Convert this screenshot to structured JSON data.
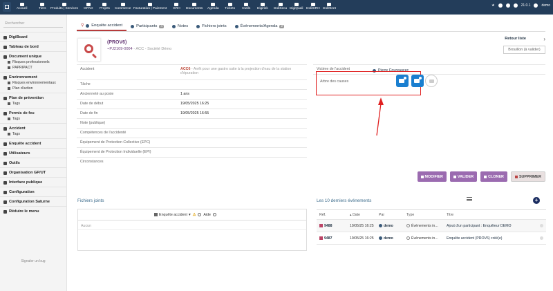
{
  "topbar": {
    "items": [
      "Accueil",
      "Tiers",
      "Produits | Services",
      "GPAO",
      "Projets",
      "Commerce",
      "Facturation | Paiement",
      "GRH",
      "Documents",
      "Agenda",
      "Tickets",
      "Outils",
      "Digirisk",
      "DoliSecu",
      "DigiQuali",
      "DoliSIRH",
      "DoliMeet"
    ],
    "version": "21.0.1",
    "user": "demo"
  },
  "sidebar": {
    "search_placeholder": "Rechercher",
    "groups": [
      {
        "label": "DigiBoard",
        "subs": []
      },
      {
        "label": "Tableau de bord",
        "subs": []
      },
      {
        "label": "Document unique",
        "subs": [
          "Risques professionnels",
          "PAPRIPACT"
        ]
      },
      {
        "label": "Environnement",
        "subs": [
          "Risques environnementaux",
          "Plan d'action"
        ]
      },
      {
        "label": "Plan de prévention",
        "subs": [
          "Tags"
        ]
      },
      {
        "label": "Permis de feu",
        "subs": [
          "Tags"
        ]
      },
      {
        "label": "Accident",
        "subs": [
          "Tags"
        ]
      },
      {
        "label": "Enquête accident",
        "subs": []
      },
      {
        "label": "Utilisateurs",
        "subs": []
      },
      {
        "label": "Outils",
        "subs": []
      },
      {
        "label": "Organisation GP/UT",
        "subs": []
      },
      {
        "label": "Interface publique",
        "subs": []
      },
      {
        "label": "Configuration",
        "subs": []
      },
      {
        "label": "Configuration Saturne",
        "subs": []
      },
      {
        "label": "Réduire le menu",
        "subs": []
      }
    ],
    "bug": "Signaler un bug"
  },
  "tabs": [
    {
      "label": "Enquête accident",
      "badge": ""
    },
    {
      "label": "Participants",
      "badge": "4"
    },
    {
      "label": "Notes",
      "badge": ""
    },
    {
      "label": "Fichiers joints",
      "badge": ""
    },
    {
      "label": "Événements/Agenda",
      "badge": "2"
    }
  ],
  "record": {
    "ref": "(PROV6)",
    "ref2": "PJ2109-0004",
    "ref2_suffix": "- ACC - Société Démo",
    "back": "Retour liste",
    "status": "Brouillon (à valider)"
  },
  "fields": [
    {
      "label": "Accident",
      "value_code": "ACC6",
      "value": " - Arrêt pour une gastro suite à la projection d'eau de la station d'épuration"
    },
    {
      "label": "Tâche",
      "value_code": "",
      "value": ""
    },
    {
      "label": "Ancienneté au poste",
      "value_code": "",
      "value": "1 ans"
    },
    {
      "label": "Date de début",
      "value_code": "",
      "value": "19/05/2025 16:25"
    },
    {
      "label": "Date de fin",
      "value_code": "",
      "value": "19/05/2025 16:55"
    },
    {
      "label": "Note (publique)",
      "value_code": "",
      "value": ""
    },
    {
      "label": "Compétences de l'accidenté",
      "value_code": "",
      "value": ""
    },
    {
      "label": "Équipement de Protection Collective (EPC)",
      "value_code": "",
      "value": ""
    },
    {
      "label": "Équipement de Protection Individuelle (EPI)",
      "value_code": "",
      "value": ""
    },
    {
      "label": "Circonstances",
      "value_code": "",
      "value": ""
    }
  ],
  "right_fields": {
    "victim_label": "Victime de l'accident",
    "victim_value": "Pierre Coureaucec",
    "tree_label": "Arbre des causes"
  },
  "actions": [
    "MODIFIER",
    "VALIDER",
    "CLONER",
    "SUPPRIMER"
  ],
  "files": {
    "title": "Fichiers joints",
    "select": "Enquête accident",
    "help": "Aide",
    "empty": "Aucun"
  },
  "events": {
    "title": "Les 10 derniers événements",
    "headers": [
      "Réf.",
      "Date",
      "Par",
      "Type",
      "Titre"
    ],
    "rows": [
      {
        "ref": "9488",
        "date": "19/05/25 16:25",
        "by": "demo",
        "type": "Événements in...",
        "title": "Ajout d'un participant : Enquêteur DEMO"
      },
      {
        "ref": "9487",
        "date": "19/05/25 16:25",
        "by": "demo",
        "type": "Événements in...",
        "title": "Enquête accident (PROV6) créé(e)"
      }
    ]
  },
  "colors": {
    "nav": "#233d5a",
    "accent": "#9b6bb0",
    "highlight": "#e02020"
  }
}
